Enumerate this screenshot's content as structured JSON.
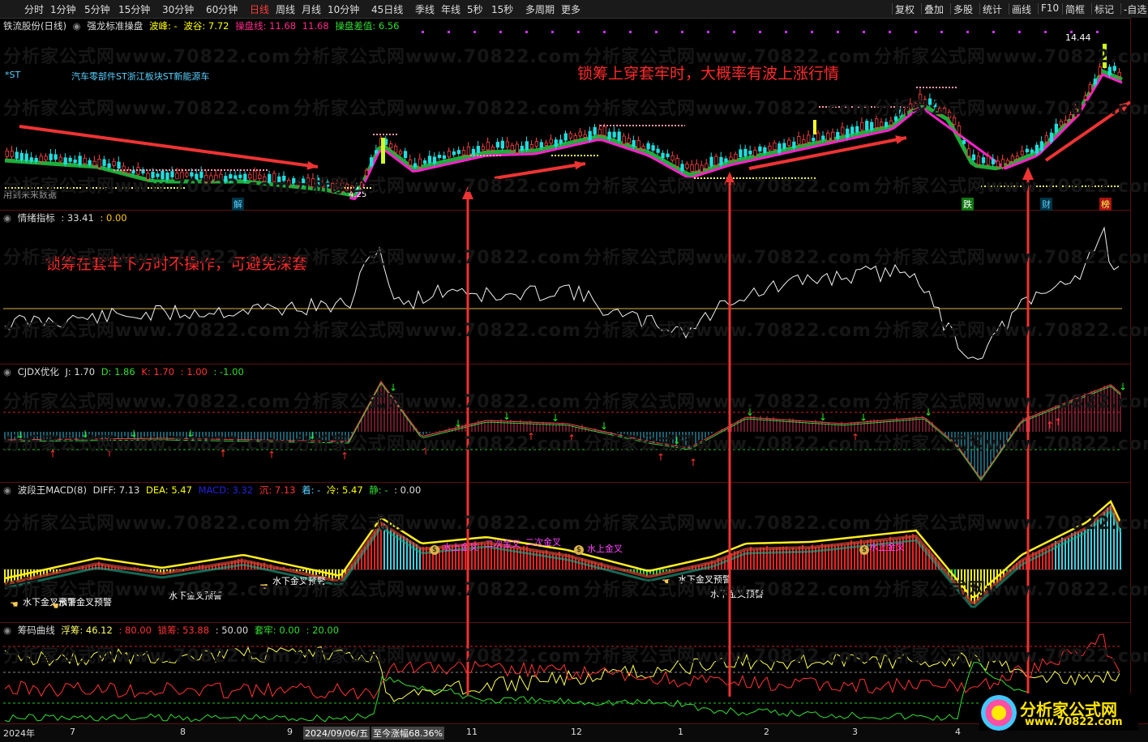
{
  "toolbar": {
    "periods": [
      "分时",
      "1分钟",
      "5分钟",
      "15分钟",
      "30分钟",
      "60分钟",
      "日线",
      "周线",
      "月线",
      "10分钟",
      "45日线",
      "季线",
      "年线",
      "5秒",
      "15秒",
      "多周期",
      "更多"
    ],
    "active_period": "日线",
    "tools": [
      "复权",
      "叠加",
      "多股",
      "统计",
      "画线",
      "F10",
      "简框",
      "标记",
      "-自选"
    ]
  },
  "main": {
    "stock_title": "铁流股份(日线)",
    "indicator_name": "强龙标准操盘",
    "bofeng": "波峰: -",
    "bogu": "波谷: 7.72",
    "caopan": "操盘线: 11.68",
    "caopan2": "11.68",
    "caopan_diff": "操盘差值: 6.56",
    "st_tag": "*ST",
    "sectors": "汽车零部件ST浙江板块ST新能源车",
    "future_data": "用到未来数据",
    "price_max": "14.44",
    "price_min": "4.25",
    "markers": {
      "jie": "解",
      "die": "跌",
      "cai": "财",
      "bang": "榜"
    }
  },
  "annotations": {
    "top": "锁筹上穿套牢时，大概率有波上涨行情",
    "mid": "锁筹在套牢下方时不操作，可避免深套"
  },
  "panel2": {
    "name": "情绪指标",
    "v1": ": 33.41",
    "v2": ": 0.00"
  },
  "panel3": {
    "name": "CJDX优化",
    "j": "J: 1.70",
    "d": "D: 1.86",
    "k": "K: 1.70",
    "v4": ": 1.00",
    "v5": ": -1.00"
  },
  "panel4": {
    "name": "波段王MACD(8)",
    "diff": "DIFF: 7.13",
    "dea": "DEA: 5.47",
    "macd": "MACD: 3.32",
    "chen": "沉: 7.13",
    "zhuo": "着: -",
    "leng": "冷: 5.47",
    "jing": "静: -",
    "v": ": 0.00",
    "labels": [
      "水下金叉预警",
      "水下金叉预警",
      "水下金叉预警",
      "水下金叉预警",
      "水下金叉预警",
      "水下金叉预警",
      "水上金叉",
      "二次金叉",
      "二次金叉",
      "水上金叉",
      "水上金叉"
    ]
  },
  "panel5": {
    "name": "筹码曲线",
    "fuchou": "浮筹: 46.12",
    "v2": ": 80.00",
    "suochou": "锁筹: 53.88",
    "v4": ": 50.00",
    "taolao": "套牢: 0.00",
    "v6": ": 20.00"
  },
  "xaxis": {
    "labels": [
      "2024年",
      "7",
      "8",
      "9",
      "2024/09/06/五",
      "至今涨幅68.36%",
      "11",
      "12",
      "1",
      "2",
      "3",
      "4"
    ]
  },
  "watermark": "分析家公式网www.70822.com",
  "logo": {
    "text": "分析家公式网",
    "url": "www.70822.com"
  }
}
